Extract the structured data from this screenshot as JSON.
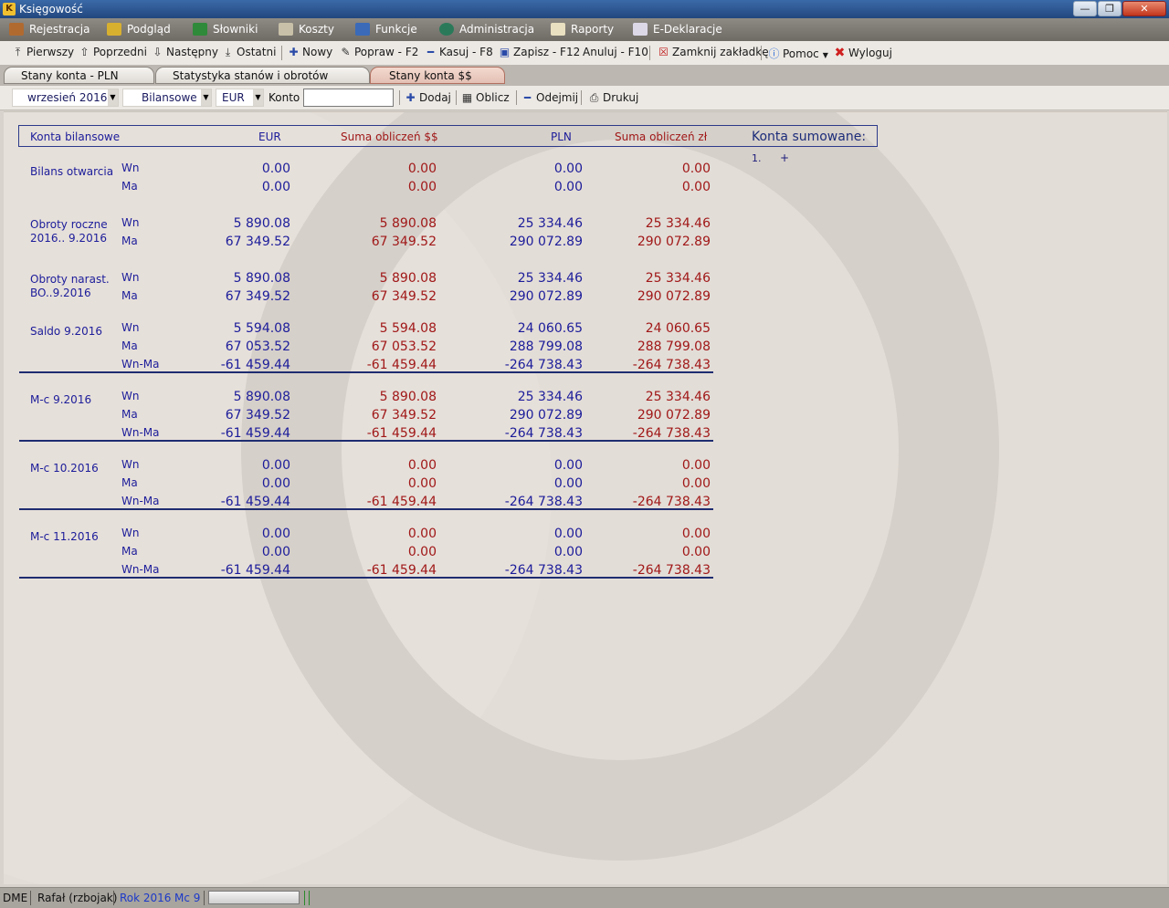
{
  "window": {
    "title": "Księgowość",
    "min": "—",
    "max": "❐",
    "close": "✕"
  },
  "menu": [
    {
      "label": "Rejestracja",
      "icon": "hammer-icon"
    },
    {
      "label": "Podgląd",
      "icon": "book-icon"
    },
    {
      "label": "Słowniki",
      "icon": "chart-icon"
    },
    {
      "label": "Koszty",
      "icon": "money-icon"
    },
    {
      "label": "Funkcje",
      "icon": "monitor-icon"
    },
    {
      "label": "Administracja",
      "icon": "globe-icon"
    },
    {
      "label": "Raporty",
      "icon": "report-icon"
    },
    {
      "label": "E-Deklaracje",
      "icon": "edeclaration-icon"
    }
  ],
  "toolbar": {
    "first": "Pierwszy",
    "prev": "Poprzedni",
    "next": "Następny",
    "last": "Ostatni",
    "new": "Nowy",
    "edit": "Popraw - F2",
    "delete": "Kasuj - F8",
    "save": "Zapisz - F12",
    "cancel": "Anuluj - F10",
    "close_tab": "Zamknij zakładkę",
    "help": "Pomoc",
    "logout": "Wyloguj"
  },
  "tabs": [
    {
      "label": "Stany konta - PLN"
    },
    {
      "label": "Statystyka stanów i obrotów"
    },
    {
      "label": "Stany konta $$"
    }
  ],
  "filters": {
    "month": "wrzesień 2016",
    "type": "Bilansowe",
    "currency": "EUR",
    "konto_label": "Konto",
    "konto_value": "",
    "add": "Dodaj",
    "calc": "Oblicz",
    "subtract": "Odejmij",
    "print": "Drukuj"
  },
  "table": {
    "headers": {
      "konta": "Konta bilansowe",
      "eur": "EUR",
      "sum_eur": "Suma obliczeń $$",
      "pln": "PLN",
      "sum_pln": "Suma obliczeń zł"
    },
    "groups": [
      {
        "label": "Bilans otwarcia",
        "rows": [
          {
            "side": "Wn",
            "eur": "0.00",
            "sum_eur": "0.00",
            "pln": "0.00",
            "sum_pln": "0.00"
          },
          {
            "side": "Ma",
            "eur": "0.00",
            "sum_eur": "0.00",
            "pln": "0.00",
            "sum_pln": "0.00"
          }
        ]
      },
      {
        "label": "Obroty roczne",
        "label2": "2016.. 9.2016",
        "rows": [
          {
            "side": "Wn",
            "eur": "5 890.08",
            "sum_eur": "5 890.08",
            "pln": "25 334.46",
            "sum_pln": "25 334.46"
          },
          {
            "side": "Ma",
            "eur": "67 349.52",
            "sum_eur": "67 349.52",
            "pln": "290 072.89",
            "sum_pln": "290 072.89"
          }
        ]
      },
      {
        "label": "Obroty narast.",
        "label2": "BO..9.2016",
        "rows": [
          {
            "side": "Wn",
            "eur": "5 890.08",
            "sum_eur": "5 890.08",
            "pln": "25 334.46",
            "sum_pln": "25 334.46"
          },
          {
            "side": "Ma",
            "eur": "67 349.52",
            "sum_eur": "67 349.52",
            "pln": "290 072.89",
            "sum_pln": "290 072.89"
          }
        ]
      },
      {
        "label": "Saldo  9.2016",
        "rows": [
          {
            "side": "Wn",
            "eur": "5 594.08",
            "sum_eur": "5 594.08",
            "pln": "24 060.65",
            "sum_pln": "24 060.65"
          },
          {
            "side": "Ma",
            "eur": "67 053.52",
            "sum_eur": "67 053.52",
            "pln": "288 799.08",
            "sum_pln": "288 799.08"
          },
          {
            "side": "Wn-Ma",
            "eur": "-61 459.44",
            "sum_eur": "-61 459.44",
            "pln": "-264 738.43",
            "sum_pln": "-264 738.43"
          }
        ]
      },
      {
        "label": "M-c 9.2016",
        "rows": [
          {
            "side": "Wn",
            "eur": "5 890.08",
            "sum_eur": "5 890.08",
            "pln": "25 334.46",
            "sum_pln": "25 334.46"
          },
          {
            "side": "Ma",
            "eur": "67 349.52",
            "sum_eur": "67 349.52",
            "pln": "290 072.89",
            "sum_pln": "290 072.89"
          },
          {
            "side": "Wn-Ma",
            "eur": "-61 459.44",
            "sum_eur": "-61 459.44",
            "pln": "-264 738.43",
            "sum_pln": "-264 738.43"
          }
        ]
      },
      {
        "label": "M-c 10.2016",
        "rows": [
          {
            "side": "Wn",
            "eur": "0.00",
            "sum_eur": "0.00",
            "pln": "0.00",
            "sum_pln": "0.00"
          },
          {
            "side": "Ma",
            "eur": "0.00",
            "sum_eur": "0.00",
            "pln": "0.00",
            "sum_pln": "0.00"
          },
          {
            "side": "Wn-Ma",
            "eur": "-61 459.44",
            "sum_eur": "-61 459.44",
            "pln": "-264 738.43",
            "sum_pln": "-264 738.43"
          }
        ]
      },
      {
        "label": "M-c 11.2016",
        "rows": [
          {
            "side": "Wn",
            "eur": "0.00",
            "sum_eur": "0.00",
            "pln": "0.00",
            "sum_pln": "0.00"
          },
          {
            "side": "Ma",
            "eur": "0.00",
            "sum_eur": "0.00",
            "pln": "0.00",
            "sum_pln": "0.00"
          },
          {
            "side": "Wn-Ma",
            "eur": "-61 459.44",
            "sum_eur": "-61 459.44",
            "pln": "-264 738.43",
            "sum_pln": "-264 738.43"
          }
        ]
      }
    ]
  },
  "konta_sumowane": {
    "title": "Konta sumowane:",
    "item": "1.",
    "plus": "+"
  },
  "status": {
    "app": "DME",
    "user": "Rafał (rzbojak)",
    "year": "Rok 2016",
    "month": "Mc 9"
  },
  "colors": {
    "blue_text": "#1c1c9a",
    "red_text": "#a01818",
    "menu_bg": "#7e7a74"
  }
}
